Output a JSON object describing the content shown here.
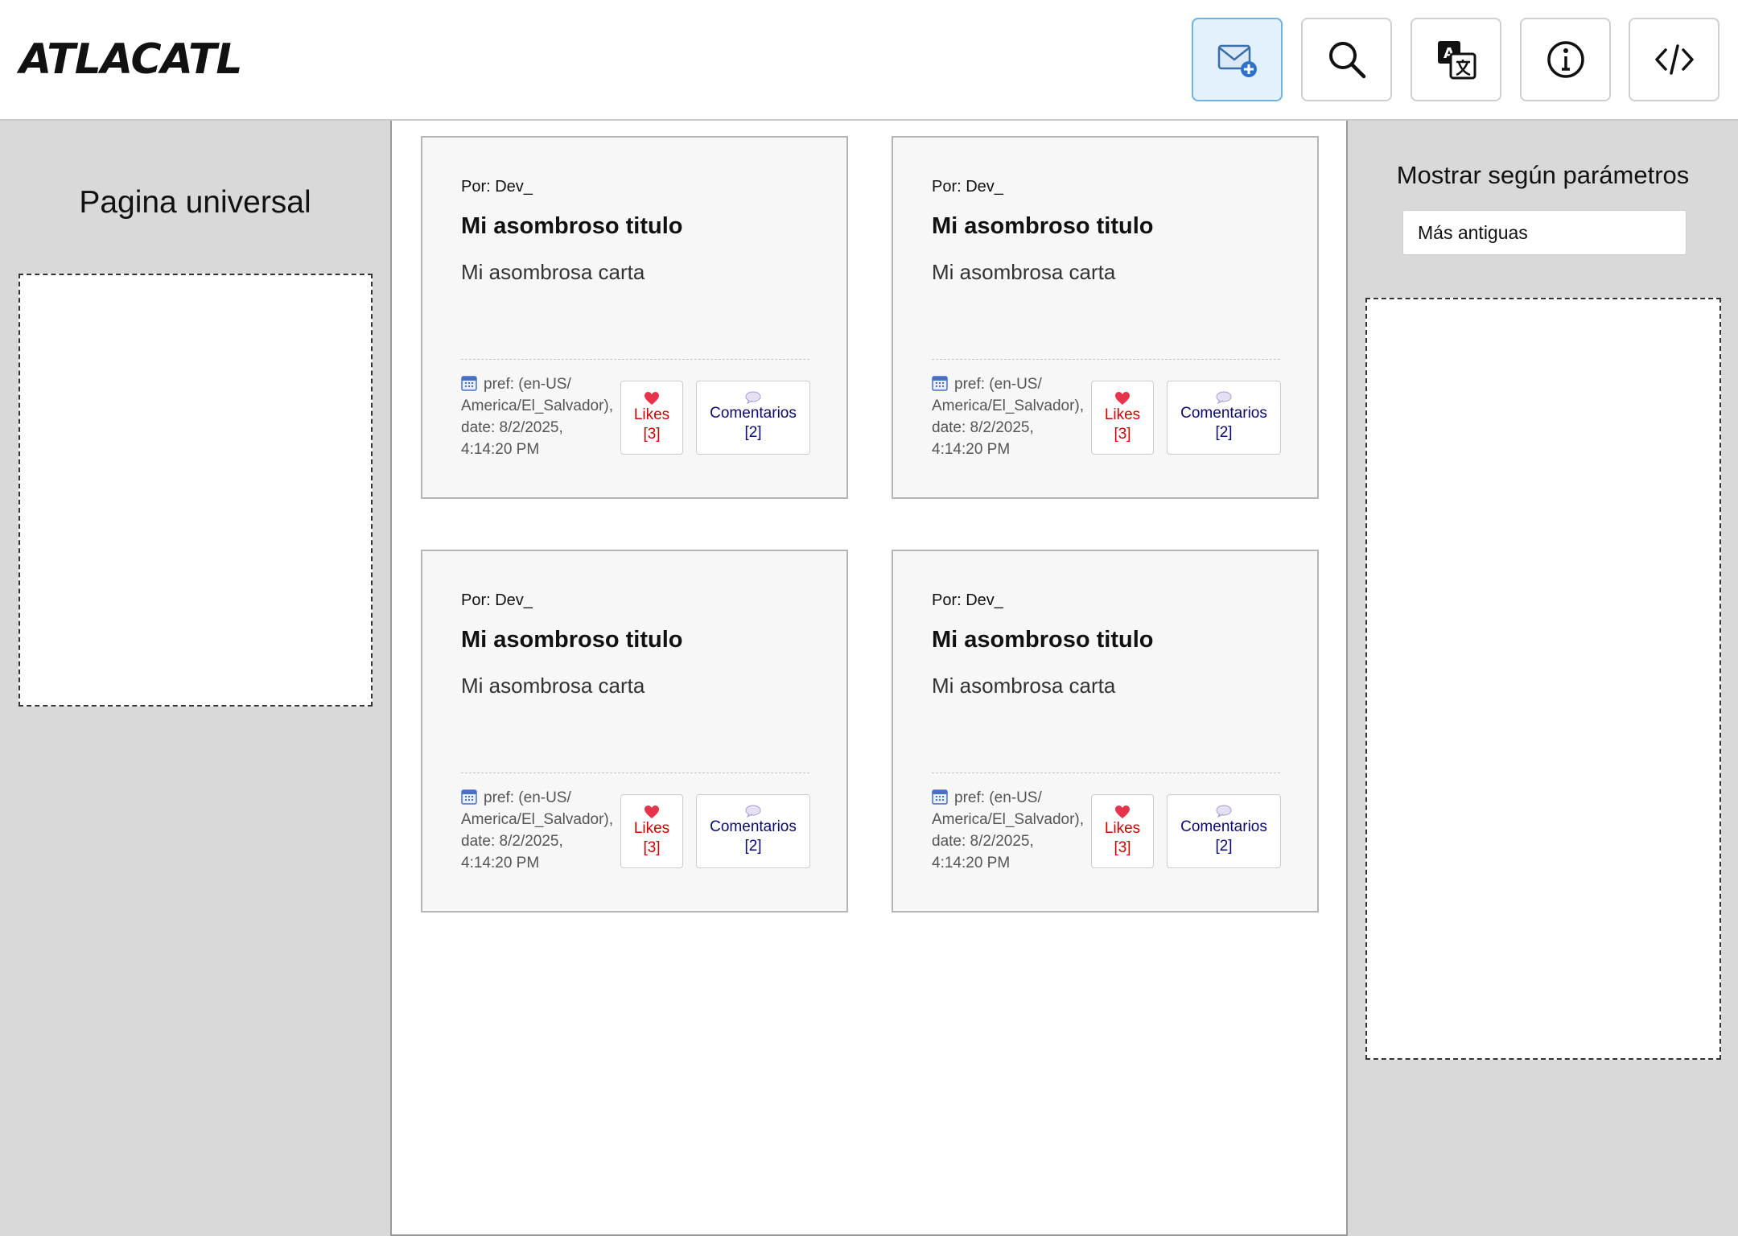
{
  "header": {
    "logo": "ATLACATL",
    "buttons": [
      {
        "icon": "new-letter-icon",
        "active": true
      },
      {
        "icon": "search-icon",
        "active": false
      },
      {
        "icon": "translate-icon",
        "active": false
      },
      {
        "icon": "info-icon",
        "active": false
      },
      {
        "icon": "code-icon",
        "active": false
      }
    ]
  },
  "left_panel": {
    "title": "Pagina universal"
  },
  "right_panel": {
    "title": "Mostrar según parámetros",
    "sort_select": {
      "selected": "Más antiguas"
    }
  },
  "cards": [
    {
      "author": "Por: Dev_",
      "title": "Mi asombroso titulo",
      "body": "Mi asombrosa carta",
      "meta_line1": "pref: (en-US/",
      "meta_line2": "America/El_Salvador),",
      "meta_line3": "date: 8/2/2025,",
      "meta_line4": "4:14:20 PM",
      "likes_label": "Likes",
      "likes_count": "[3]",
      "comments_label": "Comentarios",
      "comments_count": "[2]"
    },
    {
      "author": "Por: Dev_",
      "title": "Mi asombroso titulo",
      "body": "Mi asombrosa carta",
      "meta_line1": "pref: (en-US/",
      "meta_line2": "America/El_Salvador),",
      "meta_line3": "date: 8/2/2025,",
      "meta_line4": "4:14:20 PM",
      "likes_label": "Likes",
      "likes_count": "[3]",
      "comments_label": "Comentarios",
      "comments_count": "[2]"
    },
    {
      "author": "Por: Dev_",
      "title": "Mi asombroso titulo",
      "body": "Mi asombrosa carta",
      "meta_line1": "pref: (en-US/",
      "meta_line2": "America/El_Salvador),",
      "meta_line3": "date: 8/2/2025,",
      "meta_line4": "4:14:20 PM",
      "likes_label": "Likes",
      "likes_count": "[3]",
      "comments_label": "Comentarios",
      "comments_count": "[2]"
    },
    {
      "author": "Por: Dev_",
      "title": "Mi asombroso titulo",
      "body": "Mi asombrosa carta",
      "meta_line1": "pref: (en-US/",
      "meta_line2": "America/El_Salvador),",
      "meta_line3": "date: 8/2/2025,",
      "meta_line4": "4:14:20 PM",
      "likes_label": "Likes",
      "likes_count": "[3]",
      "comments_label": "Comentarios",
      "comments_count": "[2]"
    }
  ],
  "colors": {
    "active_button_bg": "#e3f1fc",
    "likes": "#d00000",
    "comments": "#0a0a70",
    "side_bg": "#d9d9d9"
  }
}
